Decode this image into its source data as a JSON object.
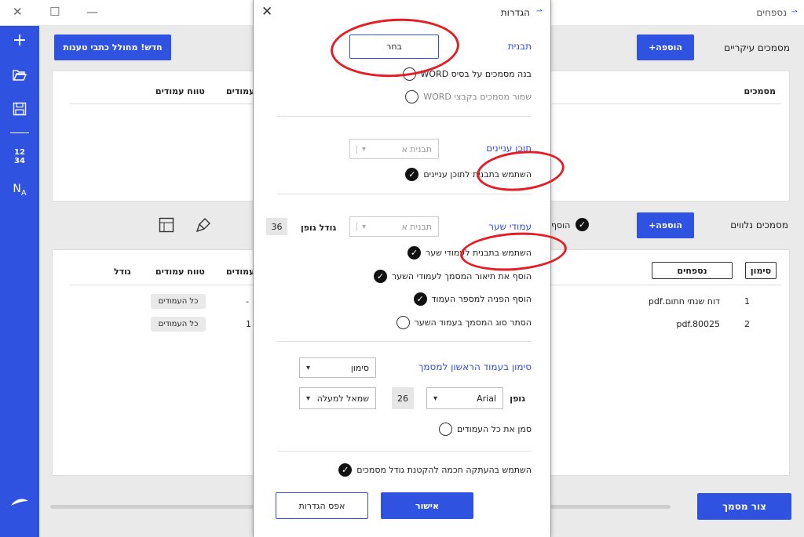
{
  "window": {
    "title": "נספחים",
    "close": "✕",
    "maximize": "☐",
    "minimize": "—"
  },
  "sidebar": {
    "icons": [
      "plus-icon",
      "folder-open-icon",
      "save-icon",
      "numbering-icon",
      "translate-icon",
      "logo-feather-icon"
    ],
    "numbering_glyph": "12\n34"
  },
  "main_docs": {
    "title": "מסמכים עיקריים",
    "add_button": "הוספה+",
    "new_extract_button": "חדש! מחולל כתבי טענות",
    "columns": {
      "documents": "מסמכים",
      "pages": "עמודים",
      "page_range": "טווח עמודים"
    }
  },
  "attached_docs": {
    "title": "מסמכים נלווים",
    "add_button": "הוספה+",
    "add_toggle_label": "הוסף",
    "columns": {
      "marker": "סימון",
      "appendices": "נספחים",
      "pages": "עמודים",
      "page_range": "טווח עמודים",
      "size": "גודל"
    },
    "rows": [
      {
        "num": "1",
        "name": "דוח שנתי חתום.pdf",
        "pages": "-",
        "range": "כל העמודים"
      },
      {
        "num": "2",
        "name": "pdf.80025",
        "pages": "1",
        "range": "כל העמודים"
      }
    ]
  },
  "create_button": "צור מסמך",
  "dialog": {
    "title": "הגדרות",
    "close": "✕",
    "template_section": "תבנית",
    "choose_button": "בחר",
    "opt_build_word": "בנה מסמכים על בסיס WORD",
    "opt_save_word": "שמור מסמכים בקבצי WORD",
    "toc_section": "תוכן עניינים",
    "toc_select": "תבנית א",
    "opt_toc_template": "השתמש בתבנית לתוכן עניינים",
    "cover_section": "עמודי שער",
    "cover_select": "תבנית א",
    "font_size_label": "גודל גופן",
    "font_size_value": "36",
    "opt_cover_template": "השתמש בתבנית לעמודי שער",
    "opt_cover_desc": "הוסף את תיאור המסמך לעמודי השער",
    "opt_page_ref": "הוסף הפניה למספר העמוד",
    "opt_hide_type": "הסתר סוג המסמך בעמוד השער",
    "first_page_section": "סימון בעמוד הראשון למסמך",
    "marker_select": "סימון",
    "font_label": "גופן",
    "font_select": "Arial",
    "font_num": "26",
    "position_select": "שמאל למעלה",
    "opt_mark_all": "סמן את כל העמודים",
    "opt_smart_copy": "השתמש בהעתקה חכמה להקטנת גודל מסמכים",
    "confirm_button": "אישור",
    "reset_button": "אפס הגדרות"
  },
  "colors": {
    "accent": "#2f52e0",
    "annotation": "#e31e24",
    "link": "#3550d8"
  }
}
